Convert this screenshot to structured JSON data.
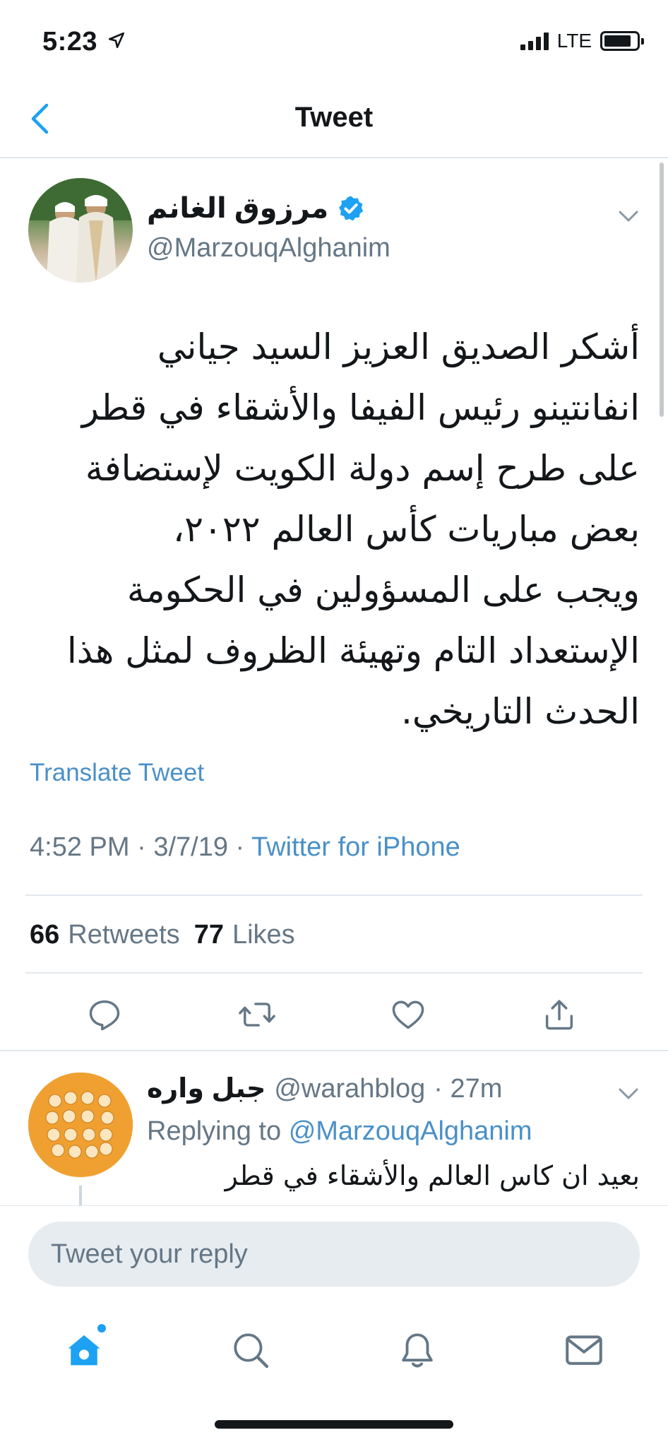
{
  "status_bar": {
    "time": "5:23",
    "network": "LTE",
    "location_icon": "location-arrow-icon",
    "signal_icon": "signal-bars-icon",
    "battery_icon": "battery-icon"
  },
  "header": {
    "title": "Tweet",
    "back_icon": "chevron-left-icon"
  },
  "tweet": {
    "author_name": "مرزوق الغانم",
    "author_handle": "@MarzouqAlghanim",
    "verified": true,
    "text_lines": [
      "أشكر الصديق العزيز السيد جياني",
      "انفانتينو رئيس الفيفا والأشقاء في قطر",
      "على طرح إسم دولة الكويت لإستضافة",
      "بعض مباريات كأس العالم ٢٠٢٢،",
      "ويجب على المسؤولين في الحكومة",
      "الإستعداد التام وتهيئة الظروف لمثل هذا",
      "الحدث التاريخي."
    ],
    "translate_label": "Translate Tweet",
    "time": "4:52 PM",
    "date": "3/7/19",
    "separator": " · ",
    "source": "Twitter for iPhone",
    "retweets_count": "66",
    "retweets_label": "Retweets",
    "likes_count": "77",
    "likes_label": "Likes"
  },
  "actions": {
    "reply_icon": "reply-bubble-icon",
    "retweet_icon": "retweet-icon",
    "like_icon": "heart-icon",
    "share_icon": "share-icon"
  },
  "reply": {
    "author_name": "جبل واره",
    "author_handle": "@warahblog",
    "time": "· 27m",
    "replying_prefix": "Replying to",
    "replying_to": "@MarzouqAlghanim",
    "text_line": "بعيد ان كاس العالم والأشقاء في قطر"
  },
  "composer": {
    "placeholder": "Tweet your reply"
  },
  "tab_bar": {
    "home_icon": "home-icon",
    "search_icon": "search-icon",
    "notifications_icon": "bell-icon",
    "messages_icon": "mail-icon"
  },
  "colors": {
    "accent": "#1da1f2",
    "link": "#4a90c8",
    "muted": "#657786",
    "text": "#14171a",
    "divider": "#e1e8ed"
  }
}
